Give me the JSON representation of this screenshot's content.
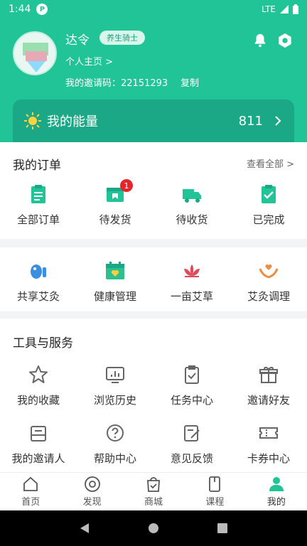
{
  "status_bar": {
    "time": "1:44",
    "network": "LTE"
  },
  "profile": {
    "name": "达令",
    "badge": "养生骑士",
    "homepage_link": "个人主页 >",
    "invite_label": "我的邀请码：22151293",
    "copy_label": "复制"
  },
  "energy": {
    "label": "我的能量",
    "value": "811"
  },
  "orders": {
    "title": "我的订单",
    "view_all": "查看全部 >",
    "items": [
      {
        "label": "全部订单",
        "icon": "clipboard-icon"
      },
      {
        "label": "待发货",
        "icon": "package-icon",
        "badge": "1"
      },
      {
        "label": "待收货",
        "icon": "truck-icon"
      },
      {
        "label": "已完成",
        "icon": "check-clipboard-icon"
      }
    ]
  },
  "services": {
    "items": [
      {
        "label": "共享艾灸",
        "icon": "moxa-icon"
      },
      {
        "label": "健康管理",
        "icon": "calendar-heart-icon"
      },
      {
        "label": "一亩艾草",
        "icon": "lotus-icon"
      },
      {
        "label": "艾灸调理",
        "icon": "hands-heart-icon"
      }
    ]
  },
  "tools": {
    "title": "工具与服务",
    "items": [
      {
        "label": "我的收藏",
        "icon": "star-icon"
      },
      {
        "label": "浏览历史",
        "icon": "history-icon"
      },
      {
        "label": "任务中心",
        "icon": "task-icon"
      },
      {
        "label": "邀请好友",
        "icon": "gift-icon"
      },
      {
        "label": "我的邀请人",
        "icon": "inviter-icon"
      },
      {
        "label": "帮助中心",
        "icon": "help-icon"
      },
      {
        "label": "意见反馈",
        "icon": "feedback-icon"
      },
      {
        "label": "卡券中心",
        "icon": "ticket-icon"
      }
    ]
  },
  "bottom_nav": {
    "tabs": [
      {
        "label": "首页",
        "icon": "home-icon"
      },
      {
        "label": "发现",
        "icon": "compass-icon"
      },
      {
        "label": "商城",
        "icon": "shopping-bag-icon"
      },
      {
        "label": "课程",
        "icon": "book-icon"
      },
      {
        "label": "我的",
        "icon": "user-icon",
        "active": true
      }
    ]
  },
  "colors": {
    "primary": "#20c497",
    "card": "#1aa886",
    "badge": "#e5252a"
  }
}
